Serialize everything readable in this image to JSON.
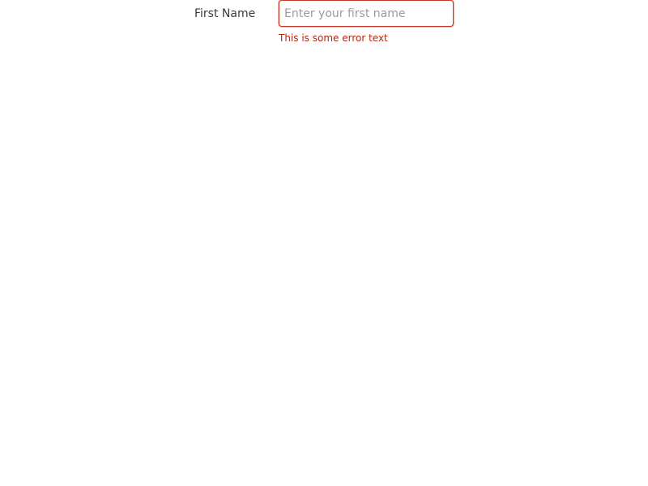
{
  "form": {
    "first_name": {
      "label": "First Name",
      "value": "",
      "placeholder": "Enter your first name",
      "error": "This is some error text"
    }
  },
  "colors": {
    "error": "#b5260f",
    "input_border_error": "#c0392b",
    "label": "#3a3a3a",
    "placeholder": "#9a9aa6"
  }
}
